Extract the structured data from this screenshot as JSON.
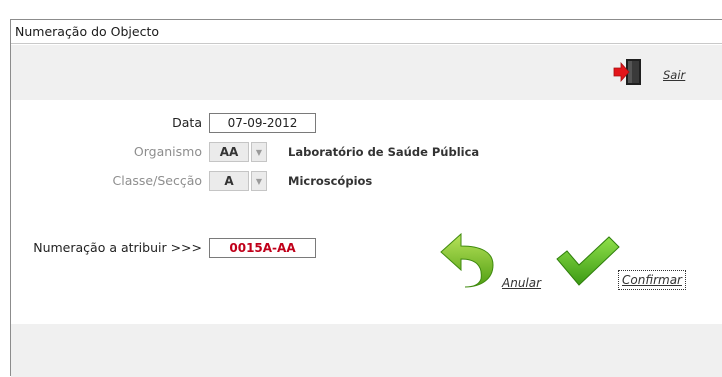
{
  "window": {
    "title": "Numeração do Objecto"
  },
  "toolbar": {
    "exit_label": "Sair",
    "exit_icon": "exit-door-icon"
  },
  "form": {
    "date": {
      "label": "Data",
      "value": "07-09-2012"
    },
    "organism": {
      "label": "Organismo",
      "code": "AA",
      "description": "Laboratório de Saúde Pública"
    },
    "class_section": {
      "label": "Classe/Secção",
      "code": "A",
      "description": "Microscópios"
    },
    "numbering": {
      "label": "Numeração a atribuir >>>",
      "value": "0015A-AA",
      "value_color": "#c0001a"
    }
  },
  "actions": {
    "cancel_label": "Anular",
    "cancel_icon": "undo-arrow-icon",
    "confirm_label": "Confirmar",
    "confirm_icon": "checkmark-icon"
  },
  "colors": {
    "accent_red": "#c0001a",
    "check_green": "#5fbf1f",
    "arrow_green": "#7cc62a",
    "panel_gray": "#f0f0f0"
  }
}
